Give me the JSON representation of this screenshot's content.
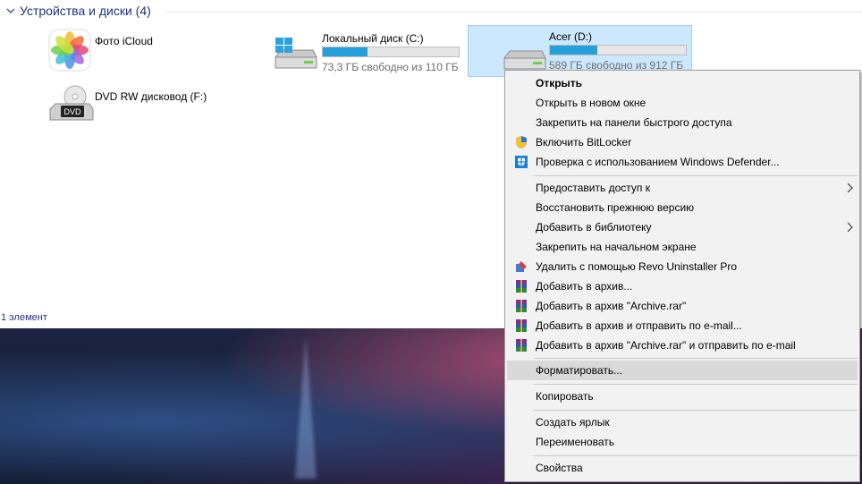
{
  "group": {
    "title": "Устройства и диски (4)"
  },
  "tiles": [
    {
      "name": "Фото iCloud",
      "icon": "icloud-photos-icon"
    },
    {
      "name": "Локальный диск (C:)",
      "free": "73,3 ГБ свободно из 110 ГБ",
      "used_fraction": 0.33,
      "icon": "windows-drive-icon"
    },
    {
      "name": "Acer (D:)",
      "free": "589 ГБ свободно из 912 ГБ",
      "used_fraction": 0.35,
      "icon": "hard-drive-icon",
      "selected": true
    },
    {
      "name": "DVD RW дисковод (F:)",
      "icon": "dvd-drive-icon",
      "icon_text": "DVD"
    }
  ],
  "status": {
    "text": "1 элемент"
  },
  "context_menu": {
    "open": "Открыть",
    "open_new_window": "Открыть в новом окне",
    "pin_quick_access": "Закрепить на панели быстрого доступа",
    "bitlocker": "Включить BitLocker",
    "defender": "Проверка с использованием Windows Defender...",
    "give_access": "Предоставить доступ к",
    "restore_previous": "Восстановить прежнюю версию",
    "add_to_library": "Добавить в библиотеку",
    "pin_start": "Закрепить на начальном экране",
    "revo": "Удалить с помощью Revo Uninstaller Pro",
    "add_archive": "Добавить в архив...",
    "add_archive_rar": "Добавить в архив \"Archive.rar\"",
    "add_archive_email": "Добавить в архив и отправить по e-mail...",
    "add_archive_rar_email": "Добавить в архив \"Archive.rar\" и отправить по e-mail",
    "format": "Форматировать...",
    "copy": "Копировать",
    "create_shortcut": "Создать ярлык",
    "rename": "Переименовать",
    "properties": "Свойства"
  },
  "colors": {
    "accent": "#26a0da",
    "selection": "#cce8ff",
    "header_text": "#1e3287"
  }
}
